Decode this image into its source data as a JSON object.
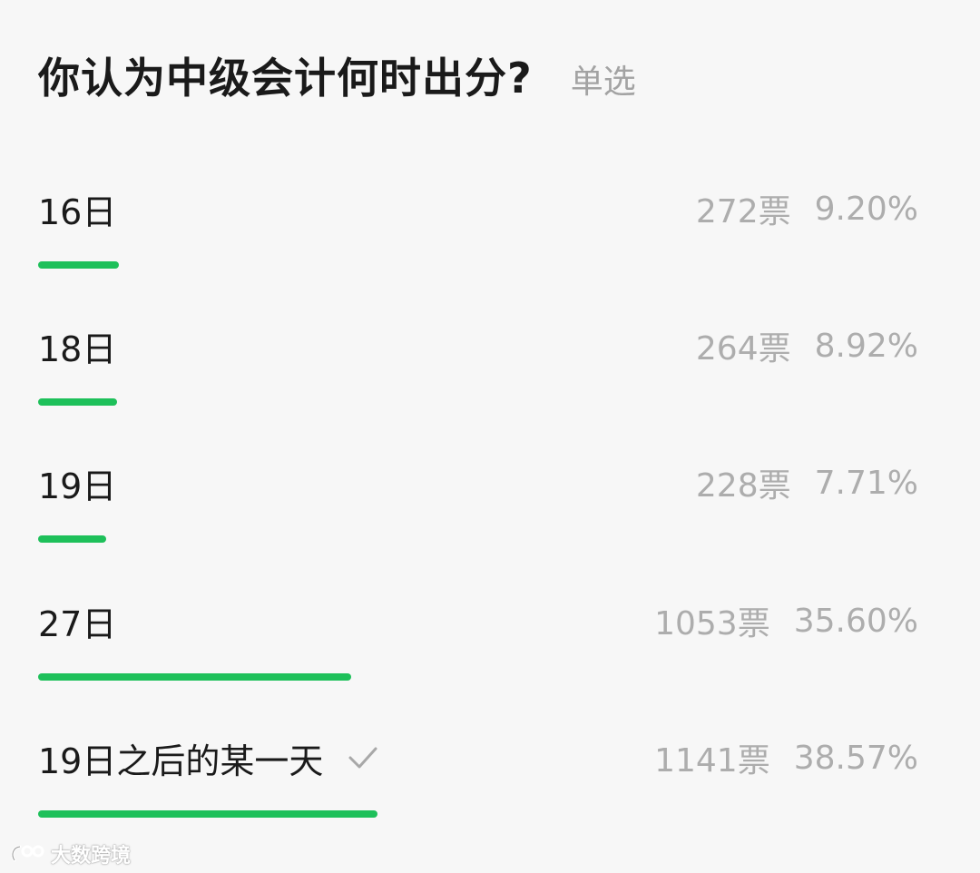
{
  "poll": {
    "question": "你认为中级会计何时出分?",
    "type_label": "单选",
    "accent_color": "#1ec05a",
    "options": [
      {
        "label": "16日",
        "votes": "272票",
        "percent": "9.20%",
        "fraction": 0.092,
        "selected": false
      },
      {
        "label": "18日",
        "votes": "264票",
        "percent": "8.92%",
        "fraction": 0.0892,
        "selected": false
      },
      {
        "label": "19日",
        "votes": "228票",
        "percent": "7.71%",
        "fraction": 0.0771,
        "selected": false
      },
      {
        "label": "27日",
        "votes": "1053票",
        "percent": "35.60%",
        "fraction": 0.356,
        "selected": false
      },
      {
        "label": "19日之后的某一天",
        "votes": "1141票",
        "percent": "38.57%",
        "fraction": 0.3857,
        "selected": true
      }
    ]
  },
  "watermark": {
    "text": "大数跨境",
    "icon": "brand-logo-icon"
  }
}
